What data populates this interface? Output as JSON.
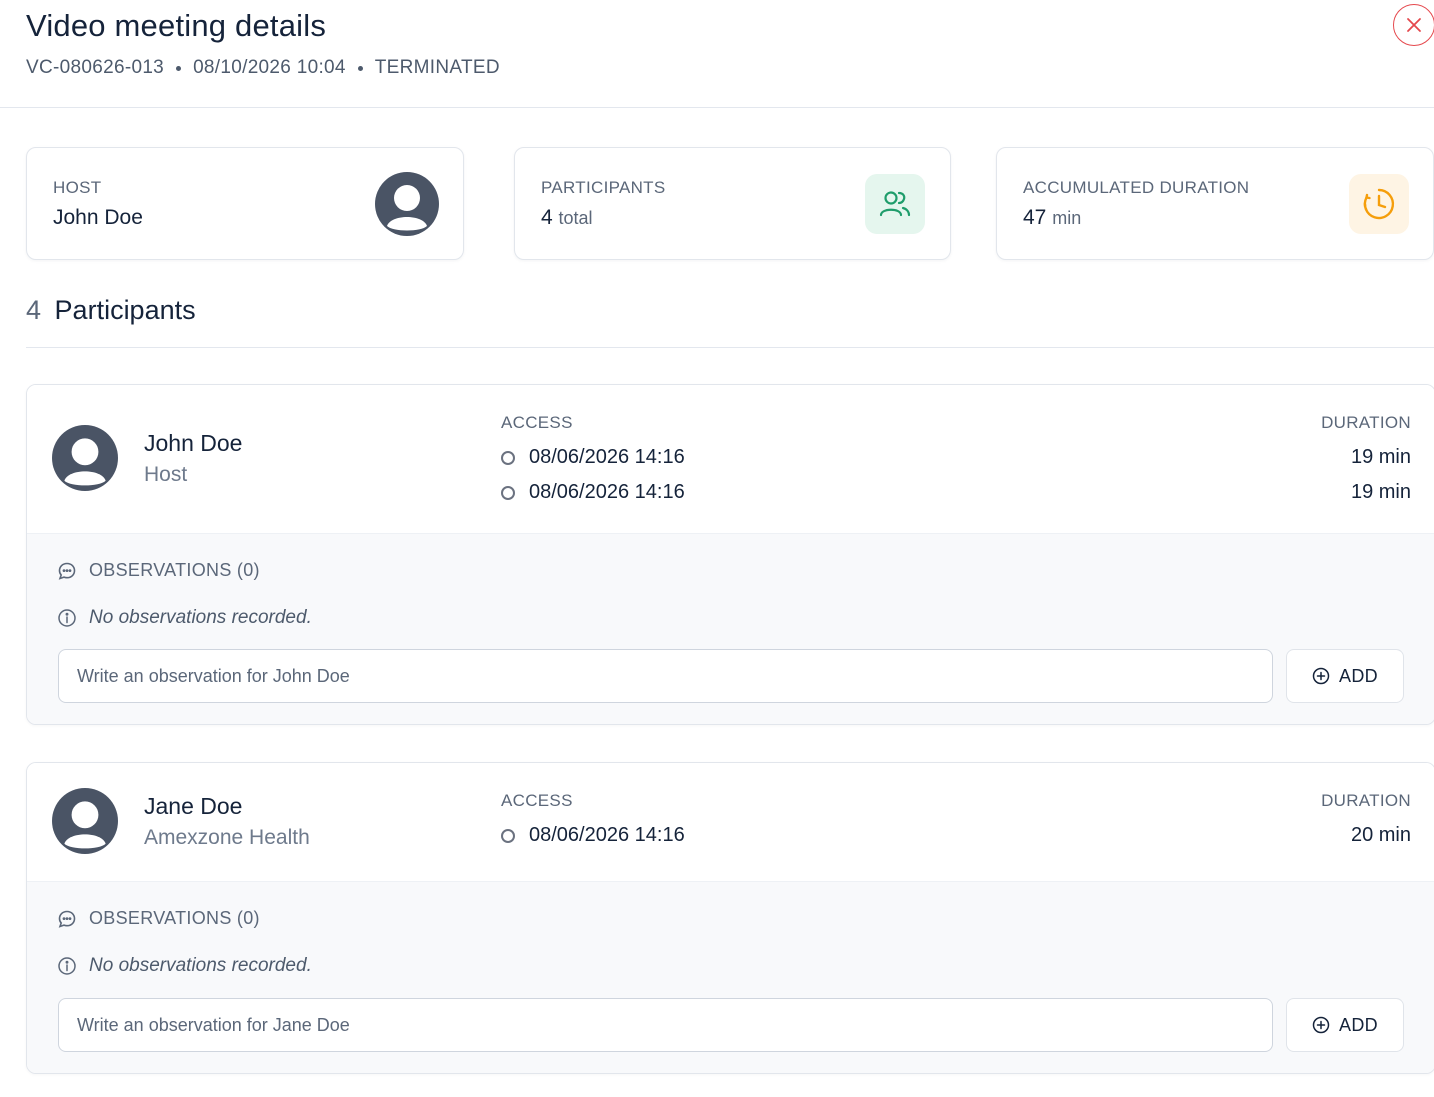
{
  "header": {
    "title": "Video meeting details",
    "meeting_id": "VC-080626-013",
    "datetime": "08/10/2026 10:04",
    "status": "TERMINATED"
  },
  "stats": {
    "host": {
      "label": "HOST",
      "value": "John Doe"
    },
    "participants": {
      "label": "PARTICIPANTS",
      "value": "4",
      "unit": "total"
    },
    "duration": {
      "label": "ACCUMULATED DURATION",
      "value": "47",
      "unit": "min"
    }
  },
  "section": {
    "count": "4",
    "title": "Participants"
  },
  "colors": {
    "accent_green": "#1f9d6b",
    "accent_orange": "#f59e0b",
    "danger": "#e5484d"
  },
  "labels": {
    "access": "ACCESS",
    "duration": "DURATION",
    "observations": "OBSERVATIONS (0)",
    "no_observations": "No observations recorded.",
    "add": "ADD"
  },
  "participants": [
    {
      "name": "John Doe",
      "role": "Host",
      "access": [
        "08/06/2026 14:16",
        "08/06/2026 14:16"
      ],
      "durations": [
        "19 min",
        "19 min"
      ],
      "placeholder": "Write an observation for John Doe"
    },
    {
      "name": "Jane Doe",
      "role": "Amexzone Health",
      "access": [
        "08/06/2026 14:16"
      ],
      "durations": [
        "20 min"
      ],
      "placeholder": "Write an observation for Jane Doe"
    }
  ]
}
